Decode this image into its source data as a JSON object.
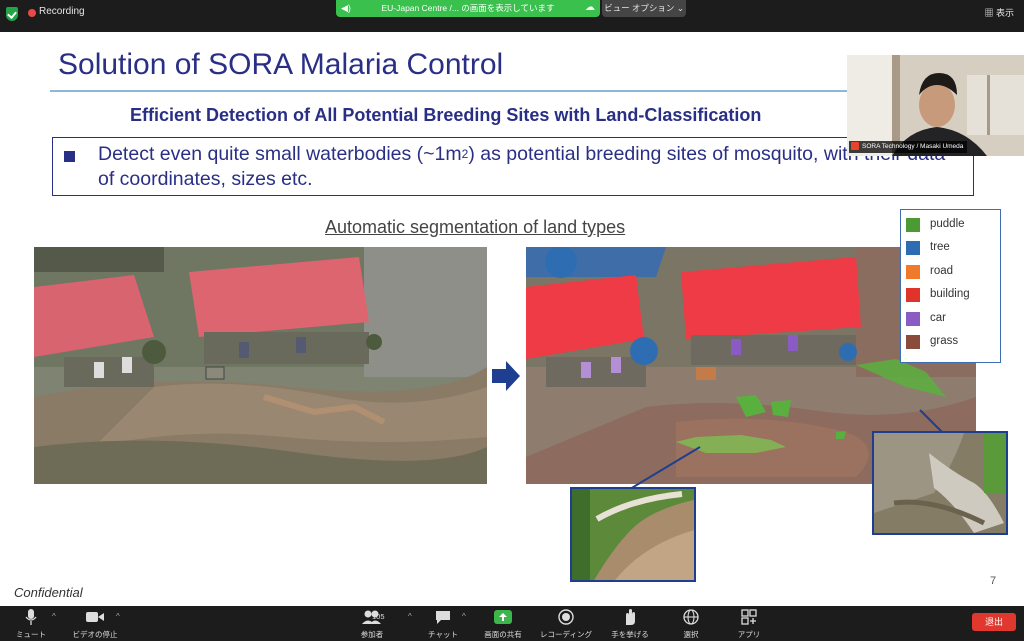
{
  "topbar": {
    "recording_label": "Recording",
    "share_title": "EU-Japan Centre /... の画面を表示しています",
    "view_options": "ビュー オプション",
    "display_label": "表示"
  },
  "slide": {
    "title": "Solution of SORA Malaria Control",
    "subheading": "Efficient Detection of All Potential Breeding Sites with Land-Classification",
    "bullet_text_part1": "Detect even quite small waterbodies (~1m",
    "bullet_text_sup": "2",
    "bullet_text_part2": ") as potential breeding sites of mosquito, with their data of coordinates, sizes etc.",
    "segmentation_caption": "Automatic segmentation of land types",
    "legend": [
      {
        "label": "puddle",
        "color": "#4c9a34"
      },
      {
        "label": "tree",
        "color": "#2f6db2"
      },
      {
        "label": "road",
        "color": "#ef7a2c"
      },
      {
        "label": "building",
        "color": "#e0342a"
      },
      {
        "label": "car",
        "color": "#8b5bc4"
      },
      {
        "label": "grass",
        "color": "#8a4b3a"
      }
    ],
    "confidential": "Confidential",
    "page_number": "7"
  },
  "webcam": {
    "name_label": "SORA Technology / Masaki Umeda"
  },
  "toolbar": {
    "mute": "ミュート",
    "stop_video": "ビデオの停止",
    "participants": "参加者",
    "participants_count": "105",
    "chat": "チャット",
    "share_screen": "画面の共有",
    "recording": "レコーディング",
    "raise_hand": "手を挙げる",
    "reactions": "選択",
    "apps": "アプリ",
    "leave": "退出"
  }
}
